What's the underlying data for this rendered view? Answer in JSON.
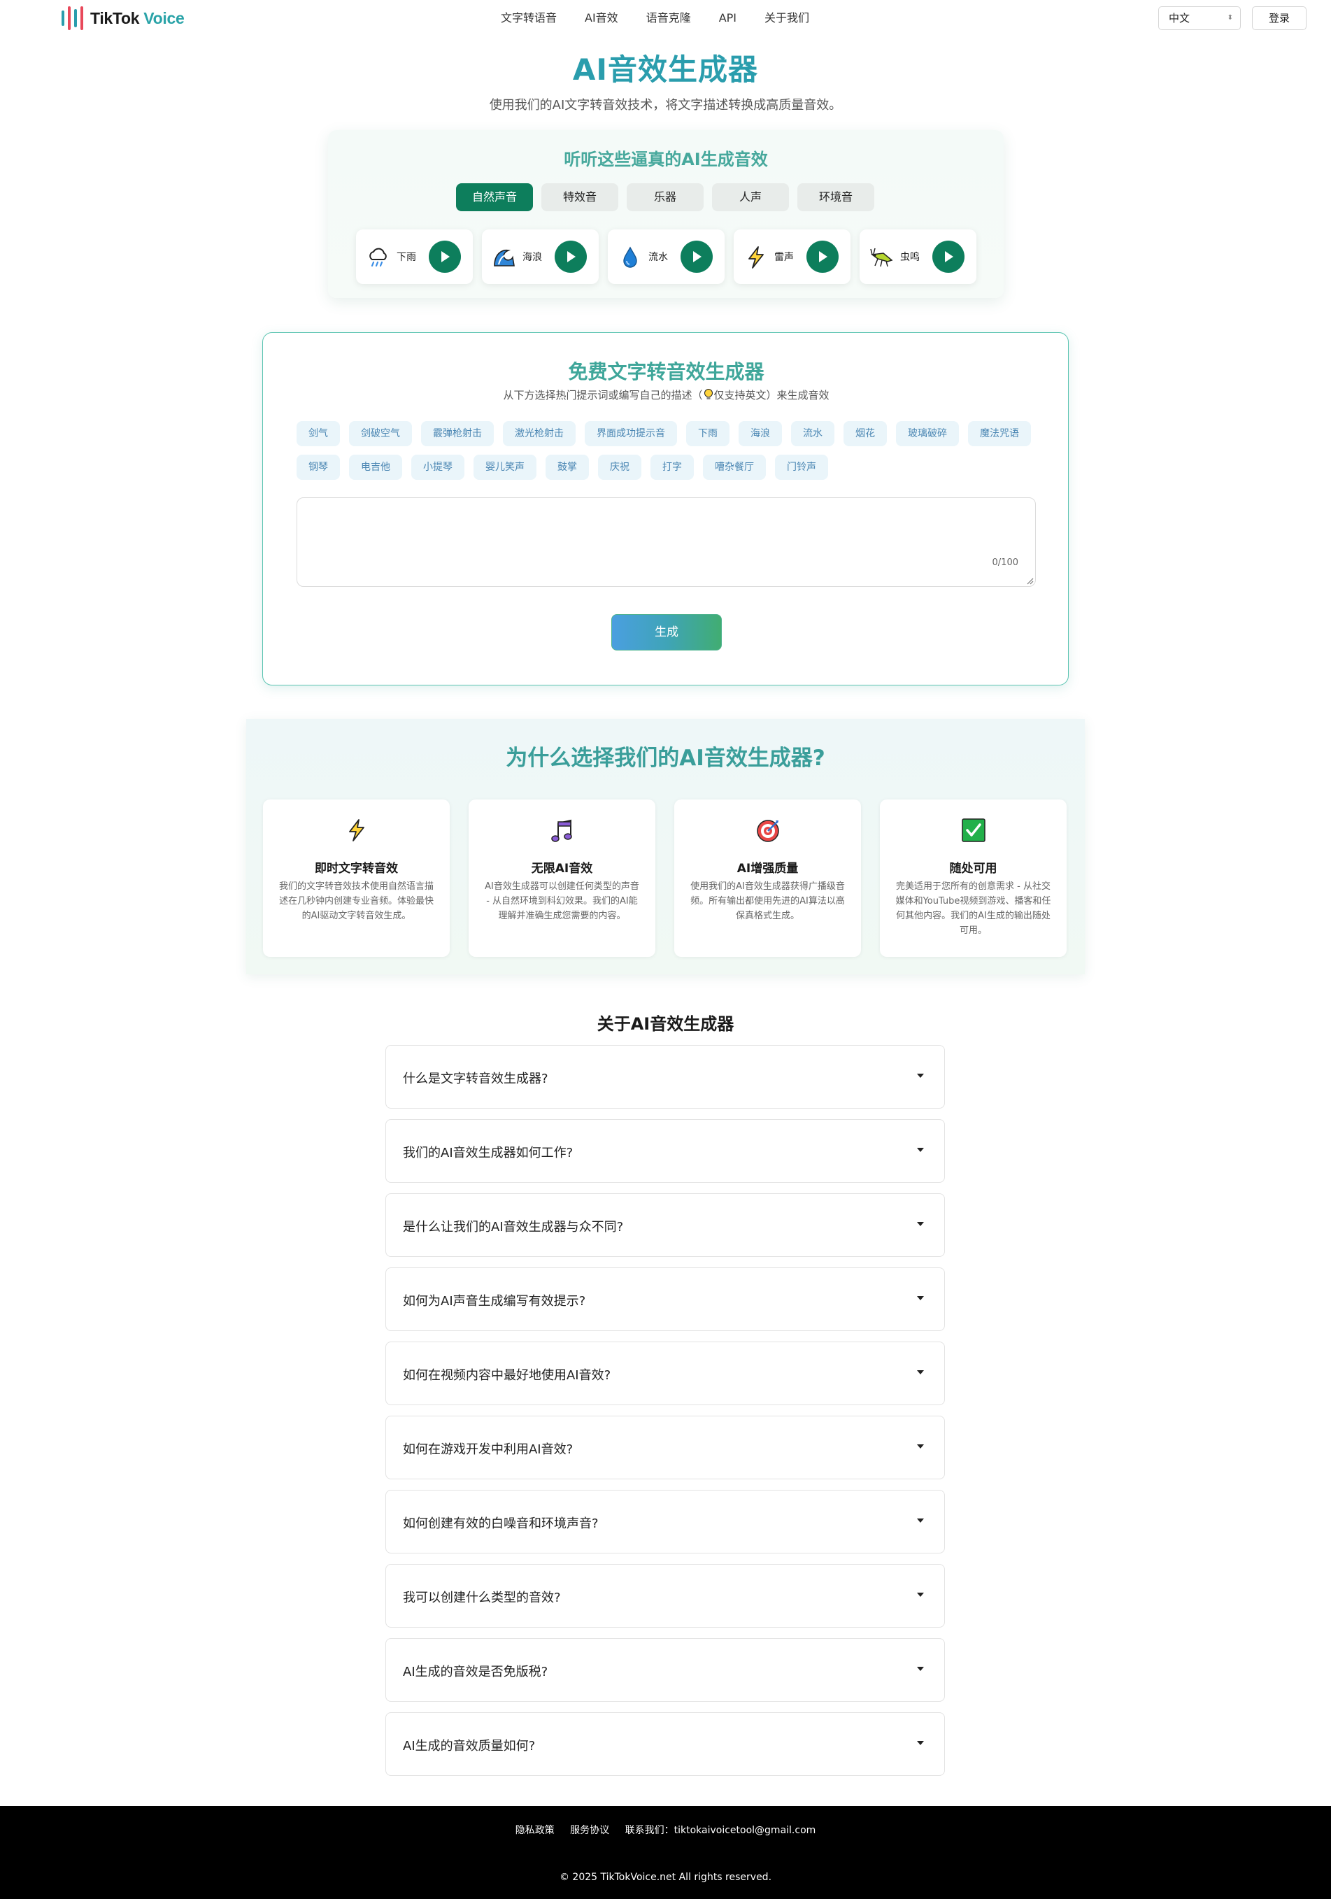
{
  "header": {
    "logo_text_1": "TikTok",
    "logo_text_2": "Voice",
    "nav": [
      "文字转语音",
      "AI音效",
      "语音克隆",
      "API",
      "关于我们"
    ],
    "language": "中文",
    "login_label": "登录"
  },
  "hero": {
    "title": "AI音效生成器",
    "subtitle": "使用我们的AI文字转音效技术，将文字描述转换成高质量音效。"
  },
  "showcase": {
    "title": "听听这些逼真的AI生成音效",
    "tabs": [
      "自然声音",
      "特效音",
      "乐器",
      "人声",
      "环境音"
    ],
    "active_tab": "自然声音",
    "sounds": [
      {
        "label": "下雨",
        "icon": "rain-cloud-icon"
      },
      {
        "label": "海浪",
        "icon": "wave-icon"
      },
      {
        "label": "流水",
        "icon": "water-drop-icon"
      },
      {
        "label": "雷声",
        "icon": "lightning-icon"
      },
      {
        "label": "虫鸣",
        "icon": "cricket-icon"
      }
    ]
  },
  "generator": {
    "title": "免费文字转音效生成器",
    "subtitle_before": "从下方选择热门提示词或编写自己的描述（",
    "subtitle_after": "仅支持英文）来生成音效",
    "chips": [
      "剑气",
      "剑破空气",
      "霰弹枪射击",
      "激光枪射击",
      "界面成功提示音",
      "下雨",
      "海浪",
      "流水",
      "烟花",
      "玻璃破碎",
      "魔法咒语",
      "钢琴",
      "电吉他",
      "小提琴",
      "婴儿笑声",
      "鼓掌",
      "庆祝",
      "打字",
      "嘈杂餐厅",
      "门铃声"
    ],
    "counter": "0/100",
    "generate_label": "生成"
  },
  "why": {
    "title": "为什么选择我们的AI音效生成器?",
    "features": [
      {
        "icon": "lightning-icon",
        "title": "即时文字转音效",
        "desc": "我们的文字转音效技术使用自然语言描述在几秒钟内创建专业音频。体验最快的AI驱动文字转音效生成。"
      },
      {
        "icon": "music-note-icon",
        "title": "无限AI音效",
        "desc": "AI音效生成器可以创建任何类型的声音 - 从自然环境到科幻效果。我们的AI能理解并准确生成您需要的内容。"
      },
      {
        "icon": "target-icon",
        "title": "AI增强质量",
        "desc": "使用我们的AI音效生成器获得广播级音频。所有输出都使用先进的AI算法以高保真格式生成。"
      },
      {
        "icon": "checkmark-icon",
        "title": "随处可用",
        "desc": "完美适用于您所有的创意需求 - 从社交媒体和YouTube视频到游戏、播客和任何其他内容。我们的AI生成的输出随处可用。"
      }
    ]
  },
  "faq": {
    "title": "关于AI音效生成器",
    "items": [
      "什么是文字转音效生成器?",
      "我们的AI音效生成器如何工作?",
      "是什么让我们的AI音效生成器与众不同?",
      "如何为AI声音生成编写有效提示?",
      "如何在视频内容中最好地使用AI音效?",
      "如何在游戏开发中利用AI音效?",
      "如何创建有效的白噪音和环境声音?",
      "我可以创建什么类型的音效?",
      "AI生成的音效是否免版税?",
      "AI生成的音效质量如何?"
    ]
  },
  "footer": {
    "privacy": "隐私政策",
    "terms": "服务协议",
    "contact": "联系我们：tiktokaivoicetool@gmail.com",
    "copyright": "© 2025 TikTokVoice.net All rights reserved."
  },
  "colors": {
    "accent_green": "#0d7e5c",
    "title_teal": "#2a9dad",
    "chip_bg": "#eaf5fa",
    "chip_text": "#4a86b3"
  }
}
